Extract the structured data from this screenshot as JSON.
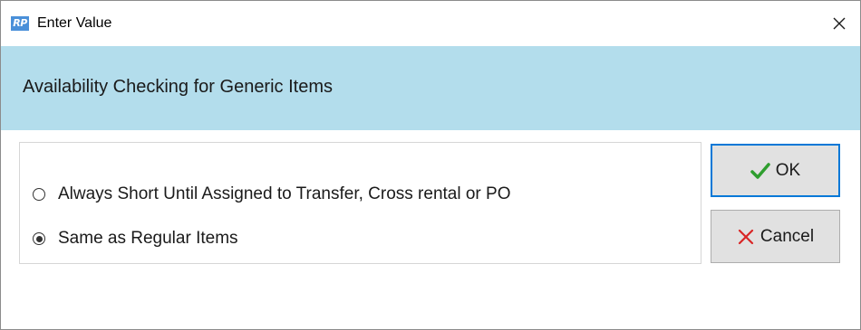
{
  "window": {
    "app_icon_text": "RP",
    "title": "Enter Value",
    "close_icon": "close-icon"
  },
  "header": {
    "text": "Availability Checking for Generic Items"
  },
  "options": [
    {
      "label": "Always Short Until Assigned to Transfer, Cross rental or PO",
      "selected": false
    },
    {
      "label": "Same as Regular Items",
      "selected": true
    }
  ],
  "buttons": {
    "ok_label": "OK",
    "ok_icon": "checkmark-icon",
    "cancel_label": "Cancel",
    "cancel_icon": "x-icon"
  },
  "colors": {
    "header_band": "#b3ddec",
    "ok_check": "#2e9e2e",
    "cancel_x": "#d92626",
    "focus_border": "#0078d7"
  }
}
